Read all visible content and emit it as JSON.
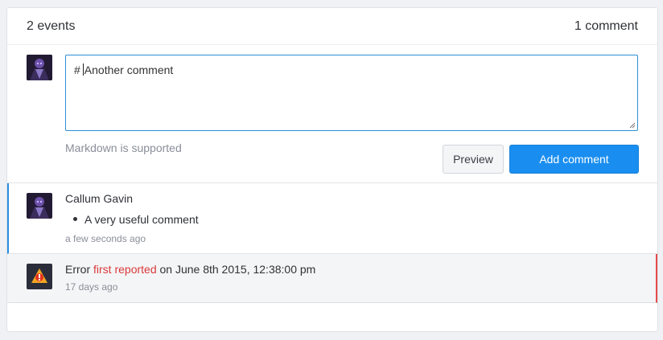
{
  "header": {
    "events_count": "2 events",
    "comments_count": "1 comment"
  },
  "composer": {
    "text_prefix": "#",
    "text": "Another comment",
    "markdown_hint": "Markdown is supported",
    "preview_label": "Preview",
    "add_label": "Add comment"
  },
  "comment": {
    "author": "Callum Gavin",
    "body_item": "A very useful comment",
    "timestamp": "a few seconds ago"
  },
  "event": {
    "prefix": "Error",
    "highlight": "first reported",
    "suffix": "on June 8th 2015, 12:38:00 pm",
    "timestamp": "17 days ago"
  },
  "colors": {
    "accent": "#1a8ef0",
    "error": "#d9393b",
    "comment_border": "#2a8ee0"
  },
  "icons": [
    "user-avatar",
    "error-badge-icon",
    "resize-grip-icon"
  ]
}
